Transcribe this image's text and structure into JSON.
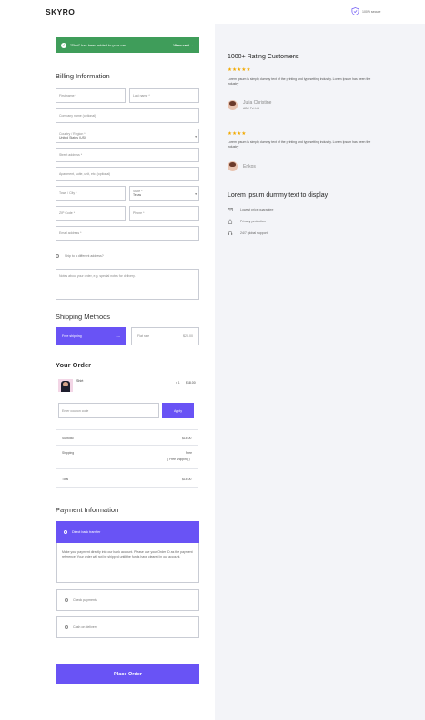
{
  "header": {
    "logo": "SKYRO",
    "secure_label": "100% secure"
  },
  "banner": {
    "message": "\"Shirt\" has been added to your cart.",
    "view_cart": "View cart →"
  },
  "billing": {
    "title": "Billing Information",
    "first_name": "First name *",
    "last_name": "Last name *",
    "company": "Company name (optional)",
    "country_label": "Country / Region *",
    "country_value": "United States (US)",
    "street": "Street address *",
    "apartment": "Apartment, suite, unit, etc. (optional)",
    "city": "Town / City *",
    "state_label": "State *",
    "state_value": "Texas",
    "zip": "ZIP Code *",
    "phone": "Phone *",
    "email": "Email address *",
    "ship_different": "Ship to a different address?",
    "notes": "Notes about your order, e.g. special notes for delivery."
  },
  "shipping": {
    "title": "Shipping Methods",
    "free_label": "Free shipping",
    "free_mark": "---",
    "flat_label": "Flat rate",
    "flat_price": "$20.00"
  },
  "order": {
    "title": "Your Order",
    "item_name": "Shirt",
    "item_qty": "x 1",
    "item_price": "$18.00",
    "coupon_placeholder": "Enter coupon code",
    "apply_label": "Apply",
    "subtotal_label": "Subtotal",
    "subtotal_value": "$18.00",
    "shipping_label": "Shipping",
    "shipping_value": "Free",
    "shipping_note": "( Free shipping )",
    "total_label": "Total",
    "total_value": "$18.00"
  },
  "payment": {
    "title": "Payment Information",
    "bank_label": "Direct bank transfer",
    "bank_desc": "Make your payment directly into our bank account. Please use your Order ID as the payment reference. Your order will not be shipped until the funds have cleared in our account.",
    "check_label": "Check payments",
    "cod_label": "Cash on delivery",
    "place_order": "Place Order"
  },
  "sidebar": {
    "title": "1000+ Rating Customers",
    "reviews": [
      {
        "stars": "★★★★★",
        "text": "Lorem Ipsum is simply dummy text of the printing and typesetting industry. Lorem Ipsum has been the industry",
        "name": "Julia Christine",
        "company": "ABC Pvt Ltd"
      },
      {
        "stars": "★★★★",
        "text": "Lorem Ipsum is simply dummy text of the printing and typesetting industry. Lorem Ipsum has been the industry",
        "name": "Erikos",
        "company": ""
      }
    ],
    "features_title": "Lorem ipsum dummy text to display",
    "features": [
      {
        "label": "Lowest price guarantee",
        "icon": "mail-icon"
      },
      {
        "label": "Privacy protection",
        "icon": "lock-icon"
      },
      {
        "label": "24/7 global support",
        "icon": "headset-icon"
      }
    ]
  },
  "colors": {
    "accent": "#6953f5",
    "success": "#3f9d5a",
    "star": "#f2a900",
    "sidebar_bg": "#f3f4f8"
  }
}
